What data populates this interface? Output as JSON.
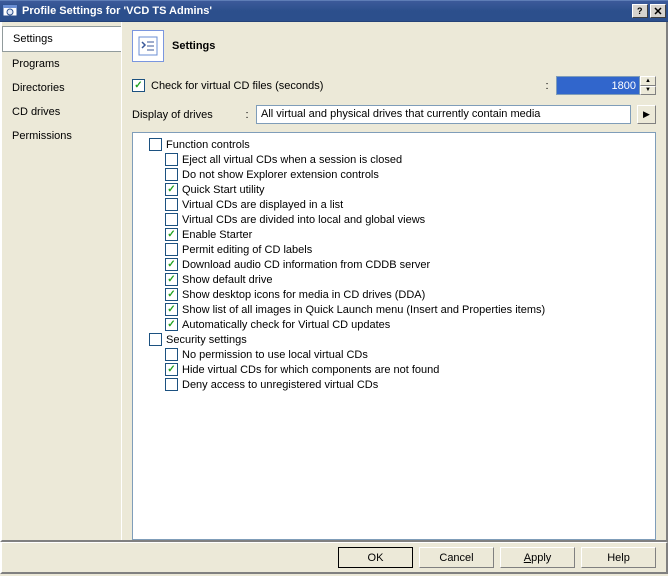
{
  "window": {
    "title": "Profile Settings for 'VCD TS Admins'"
  },
  "sidebar": {
    "items": [
      {
        "label": "Settings",
        "selected": true
      },
      {
        "label": "Programs",
        "selected": false
      },
      {
        "label": "Directories",
        "selected": false
      },
      {
        "label": "CD drives",
        "selected": false
      },
      {
        "label": "Permissions",
        "selected": false
      }
    ]
  },
  "main": {
    "header_title": "Settings",
    "check_files": {
      "checked": true,
      "label": "Check for virtual CD files (seconds)",
      "value": "1800"
    },
    "display_of_drives": {
      "label": "Display of drives",
      "value": "All virtual and physical drives that currently contain media"
    },
    "tree": {
      "function_controls": {
        "label": "Function controls",
        "checked": false,
        "items": [
          {
            "label": "Eject all virtual CDs when a session is closed",
            "checked": false
          },
          {
            "label": "Do not show Explorer extension controls",
            "checked": false
          },
          {
            "label": "Quick Start utility",
            "checked": true
          },
          {
            "label": "Virtual CDs are displayed in a list",
            "checked": false
          },
          {
            "label": "Virtual CDs are divided into local and global views",
            "checked": false
          },
          {
            "label": "Enable Starter",
            "checked": true
          },
          {
            "label": "Permit editing of CD labels",
            "checked": false
          },
          {
            "label": "Download audio CD information from CDDB server",
            "checked": true
          },
          {
            "label": "Show default drive",
            "checked": true
          },
          {
            "label": "Show desktop icons for media in CD drives (DDA)",
            "checked": true
          },
          {
            "label": "Show list of all images in Quick Launch menu (Insert and Properties items)",
            "checked": true
          },
          {
            "label": "Automatically check for Virtual CD updates",
            "checked": true
          }
        ]
      },
      "security_settings": {
        "label": "Security settings",
        "checked": false,
        "items": [
          {
            "label": "No permission to use local virtual CDs",
            "checked": false
          },
          {
            "label": "Hide virtual CDs for which components are not found",
            "checked": true
          },
          {
            "label": "Deny access to unregistered virtual CDs",
            "checked": false
          }
        ]
      }
    }
  },
  "buttons": {
    "ok": "OK",
    "cancel": "Cancel",
    "apply": "Apply",
    "help": "Help"
  },
  "colon": ":"
}
